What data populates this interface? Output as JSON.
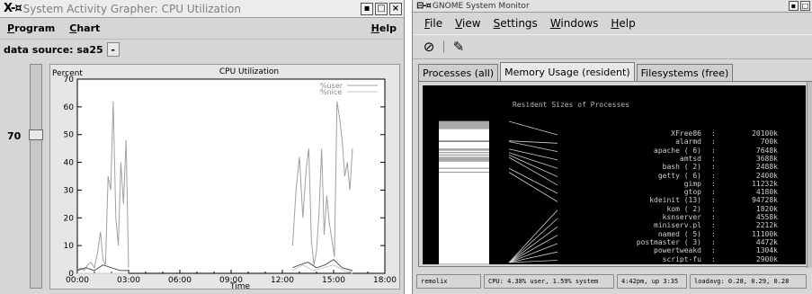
{
  "left_window": {
    "title": "System Activity Grapher: CPU Utilization",
    "logo": "X-¤",
    "menu": {
      "program": "Program",
      "chart": "Chart",
      "help": "Help"
    },
    "data_source_label": "data source: sa25",
    "data_source_button": "-",
    "slider_value": "70"
  },
  "chart_data": {
    "type": "line",
    "title": "CPU Utilization",
    "ylabel": "Percent",
    "xlabel": "Time",
    "ylim": [
      0,
      70
    ],
    "yticks": [
      "0",
      "10",
      "20",
      "30",
      "40",
      "50",
      "60",
      "70"
    ],
    "xlim": [
      0,
      18
    ],
    "xticks": [
      "00:00",
      "03:00",
      "06:00",
      "09:00",
      "12:00",
      "15:00",
      "18:00"
    ],
    "legend": "top-right",
    "series": [
      {
        "name": "%user",
        "color": "#a0a0a0",
        "x": [
          0.0,
          0.2,
          0.4,
          0.6,
          0.8,
          1.0,
          1.2,
          1.35,
          1.5,
          1.65,
          1.8,
          1.95,
          2.1,
          2.25,
          2.4,
          2.55,
          2.7,
          2.85,
          3.0,
          12.6,
          12.8,
          13.0,
          13.2,
          13.4,
          13.55,
          13.7,
          13.85,
          14.0,
          14.15,
          14.3,
          14.45,
          14.6,
          14.75,
          14.9,
          15.05,
          15.2,
          15.35,
          15.5,
          15.65,
          15.8,
          15.95,
          16.1
        ],
        "values": [
          1,
          2,
          1,
          3,
          4,
          2,
          8,
          15,
          5,
          3,
          35,
          30,
          62,
          20,
          10,
          40,
          25,
          48,
          2,
          10,
          30,
          42,
          20,
          38,
          45,
          12,
          3,
          8,
          22,
          45,
          14,
          28,
          18,
          12,
          6,
          62,
          56,
          48,
          35,
          40,
          30,
          45
        ]
      },
      {
        "name": "%nice",
        "color": "#c8c8c8",
        "x": [
          0.0,
          1.0,
          2.0,
          3.0,
          12.6,
          13.2,
          13.8,
          14.4,
          15.0,
          15.6,
          16.1
        ],
        "values": [
          0,
          0,
          0,
          0,
          1,
          3,
          1,
          2,
          3,
          1,
          0
        ]
      },
      {
        "name": "%system",
        "color": "#505050",
        "x": [
          0.0,
          0.5,
          1.0,
          1.5,
          2.0,
          2.5,
          3.0,
          12.6,
          13.0,
          13.5,
          14.0,
          14.5,
          15.0,
          15.5,
          16.1
        ],
        "values": [
          1,
          2,
          1,
          3,
          2,
          1,
          1,
          2,
          3,
          4,
          2,
          3,
          5,
          2,
          1
        ]
      }
    ]
  },
  "right_window": {
    "title": "GNOME System Monitor",
    "logo": "⊟-¤",
    "menu": [
      "File",
      "View",
      "Settings",
      "Windows",
      "Help"
    ],
    "tabs": [
      "Processes (all)",
      "Memory Usage (resident)",
      "Filesystems (free)"
    ],
    "active_tab": 1,
    "panel_title": "Resident Sizes of Processes",
    "processes": [
      {
        "name": "XFree86",
        "size": "20100k"
      },
      {
        "name": "alarmd",
        "size": "700k"
      },
      {
        "name": "apache ( 6)",
        "size": "7648k"
      },
      {
        "name": "amtsd",
        "size": "3688k"
      },
      {
        "name": "bash ( 2)",
        "size": "2488k"
      },
      {
        "name": "getty ( 6)",
        "size": "2400k"
      },
      {
        "name": "gimp",
        "size": "11232k"
      },
      {
        "name": "gtop",
        "size": "4180k"
      },
      {
        "name": "kdeinit (13)",
        "size": "94728k"
      },
      {
        "name": "kom ( 2)",
        "size": "1820k"
      },
      {
        "name": "ksnserver",
        "size": "4558k"
      },
      {
        "name": "miniserv.pl",
        "size": "2212k"
      },
      {
        "name": "named ( 5)",
        "size": "11100k"
      },
      {
        "name": "postmaster ( 3)",
        "size": "4472k"
      },
      {
        "name": "powertweakd",
        "size": "1304k"
      },
      {
        "name": "script-fu",
        "size": "2900k"
      }
    ],
    "status": {
      "host": "remolix",
      "cpu": "CPU: 4.38% user, 1.59% system",
      "uptime": "4:42pm, up 3:35",
      "load": "loadavg: 0.28, 0.29, 0.28"
    }
  }
}
